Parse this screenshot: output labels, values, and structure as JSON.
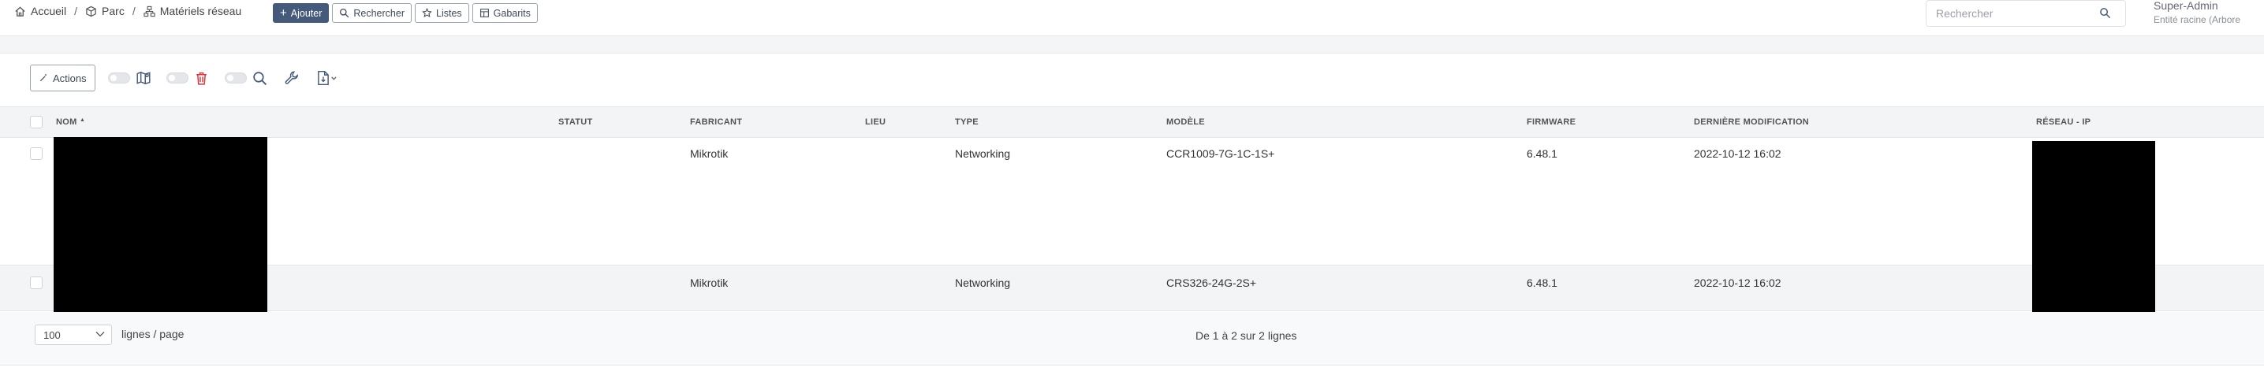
{
  "breadcrumb": {
    "home": "Accueil",
    "parc": "Parc",
    "current": "Matériels réseau",
    "separator": "/"
  },
  "toolbar_top": {
    "add": "Ajouter",
    "search": "Rechercher",
    "lists": "Listes",
    "templates": "Gabarits"
  },
  "global_search": {
    "placeholder": "Rechercher"
  },
  "user": {
    "name": "Super-Admin",
    "entity": "Entité racine (Arbore"
  },
  "actions": {
    "label": "Actions"
  },
  "table": {
    "columns": [
      "NOM",
      "STATUT",
      "FABRICANT",
      "LIEU",
      "TYPE",
      "MODÈLE",
      "FIRMWARE",
      "DERNIÈRE MODIFICATION",
      "RÉSEAU - IP"
    ],
    "sort_indicator": "▲",
    "rows": [
      {
        "nom": "",
        "statut": "",
        "fabricant": "Mikrotik",
        "lieu": "",
        "type": "Networking",
        "modele": "CCR1009-7G-1C-1S+",
        "firmware": "6.48.1",
        "modification": "2022-10-12 16:02",
        "reseau_ip": ""
      },
      {
        "nom": "",
        "statut": "",
        "fabricant": "Mikrotik",
        "lieu": "",
        "type": "Networking",
        "modele": "CRS326-24G-2S+",
        "firmware": "6.48.1",
        "modification": "2022-10-12 16:02",
        "reseau_ip": ""
      }
    ]
  },
  "pagination": {
    "page_size": "100",
    "per_page_label": "lignes / page",
    "count_text": "De 1 à 2 sur 2 lignes"
  },
  "colors": {
    "primary_button": "#45597a",
    "trash_icon": "#d9363e",
    "header_bg": "#f3f4f6"
  }
}
